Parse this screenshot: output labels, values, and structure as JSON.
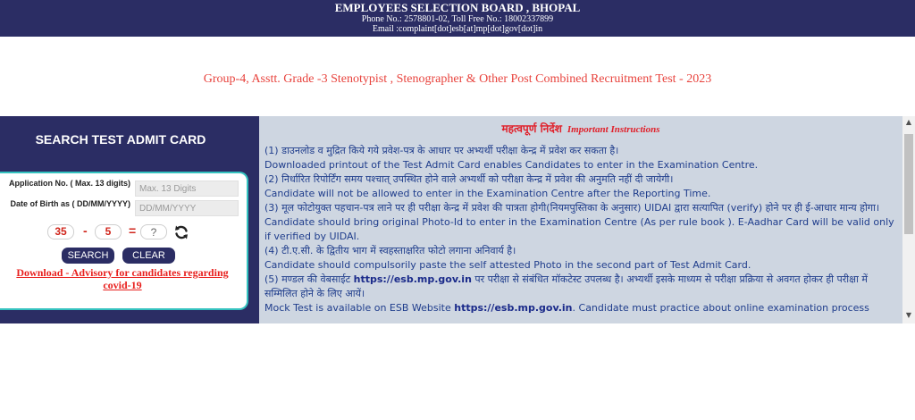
{
  "header": {
    "org": "EMPLOYEES SELECTION BOARD , BHOPAL",
    "phone": "Phone No.: 2578801-02, Toll Free No.: 18002337899",
    "email": "Email :complaint[dot]esb[at]mp[dot]gov[dot]in"
  },
  "test_title": "Group-4, Asstt. Grade -3 Stenotypist , Stenographer & Other Post Combined Recruitment Test - 2023",
  "search": {
    "title": "SEARCH TEST ADMIT CARD",
    "app_no_label": "Application  No. ( Max. 13 digits)",
    "app_no_placeholder": "Max. 13 Digits",
    "dob_label": "Date of Birth as ( DD/MM/YYYY)",
    "dob_placeholder": "DD/MM/YYYY",
    "captcha": {
      "a": "35",
      "op": "-",
      "b": "5",
      "eq": "=",
      "answer_placeholder": "?"
    },
    "search_button": "SEARCH",
    "clear_button": "CLEAR",
    "advisory_link": "Download - Advisory for candidates regarding covid-19"
  },
  "instructions": {
    "heading_hi": "महत्वपूर्ण निर्देश",
    "heading_en": "Important Instructions",
    "p1_hi": "(1)  डाउनलोड व मुद्रित किये गये प्रवेश-पत्र के आधार पर अभ्यर्थी परीक्षा केन्द्र में प्रवेश कर सकता है।",
    "p1_en": "Downloaded  printout of the Test Admit Card enables Candidates to enter in the Examination Centre.",
    "p2_hi": "(2)  निर्धारित रिपोर्टिंग समय पश्चात् उपस्थित होने वाले अभ्यर्थी को परीक्षा केन्द्र में प्रवेश की अनुमति नहीं दी जायेगी।",
    "p2_en": "Candidate will not be allowed to enter in the Examination Centre after the Reporting Time.",
    "p3_hi": "(3)   मूल फोटोयुक्त पहचान-पत्र लाने पर ही परीक्षा केन्द्र में प्रवेश की पात्रता होगी(नियमपुस्तिका के अनुसार)  UIDAI द्वारा सत्यापित (verify) होने पर ही ई-आधार मान्य होगा।",
    "p3_en": " Candidate should bring original Photo-Id to enter in the Examination Centre (As per rule book ). E-Aadhar Card will be valid only if verified by UIDAI.",
    "p4_hi": "(4)   टी.ए.सी. के द्वितीय भाग में स्वहस्ताक्षरित फोटो लगाना अनिवार्य है।",
    "p4_en": "Candidate should compulsorily paste the self attested Photo in the second part of Test Admit Card.",
    "p5_hi_pre": "(5)   मण्डल की वेबसाईट ",
    "p5_link": "https://esb.mp.gov.in",
    "p5_hi_post": " पर परीक्षा से संबंधित मॉकटेस्ट उपलब्ध है। अभ्यर्थी इसके माध्यम से परीक्षा प्रक्रिया से अवगत होकर ही परीक्षा में सम्मिलित होने के लिए आयें।",
    "p5_en_pre": "Mock Test is available on ESB Website ",
    "p5_en_link": "https://esb.mp.gov.in",
    "p5_en_post": ". Candidate must practice about online examination process"
  }
}
